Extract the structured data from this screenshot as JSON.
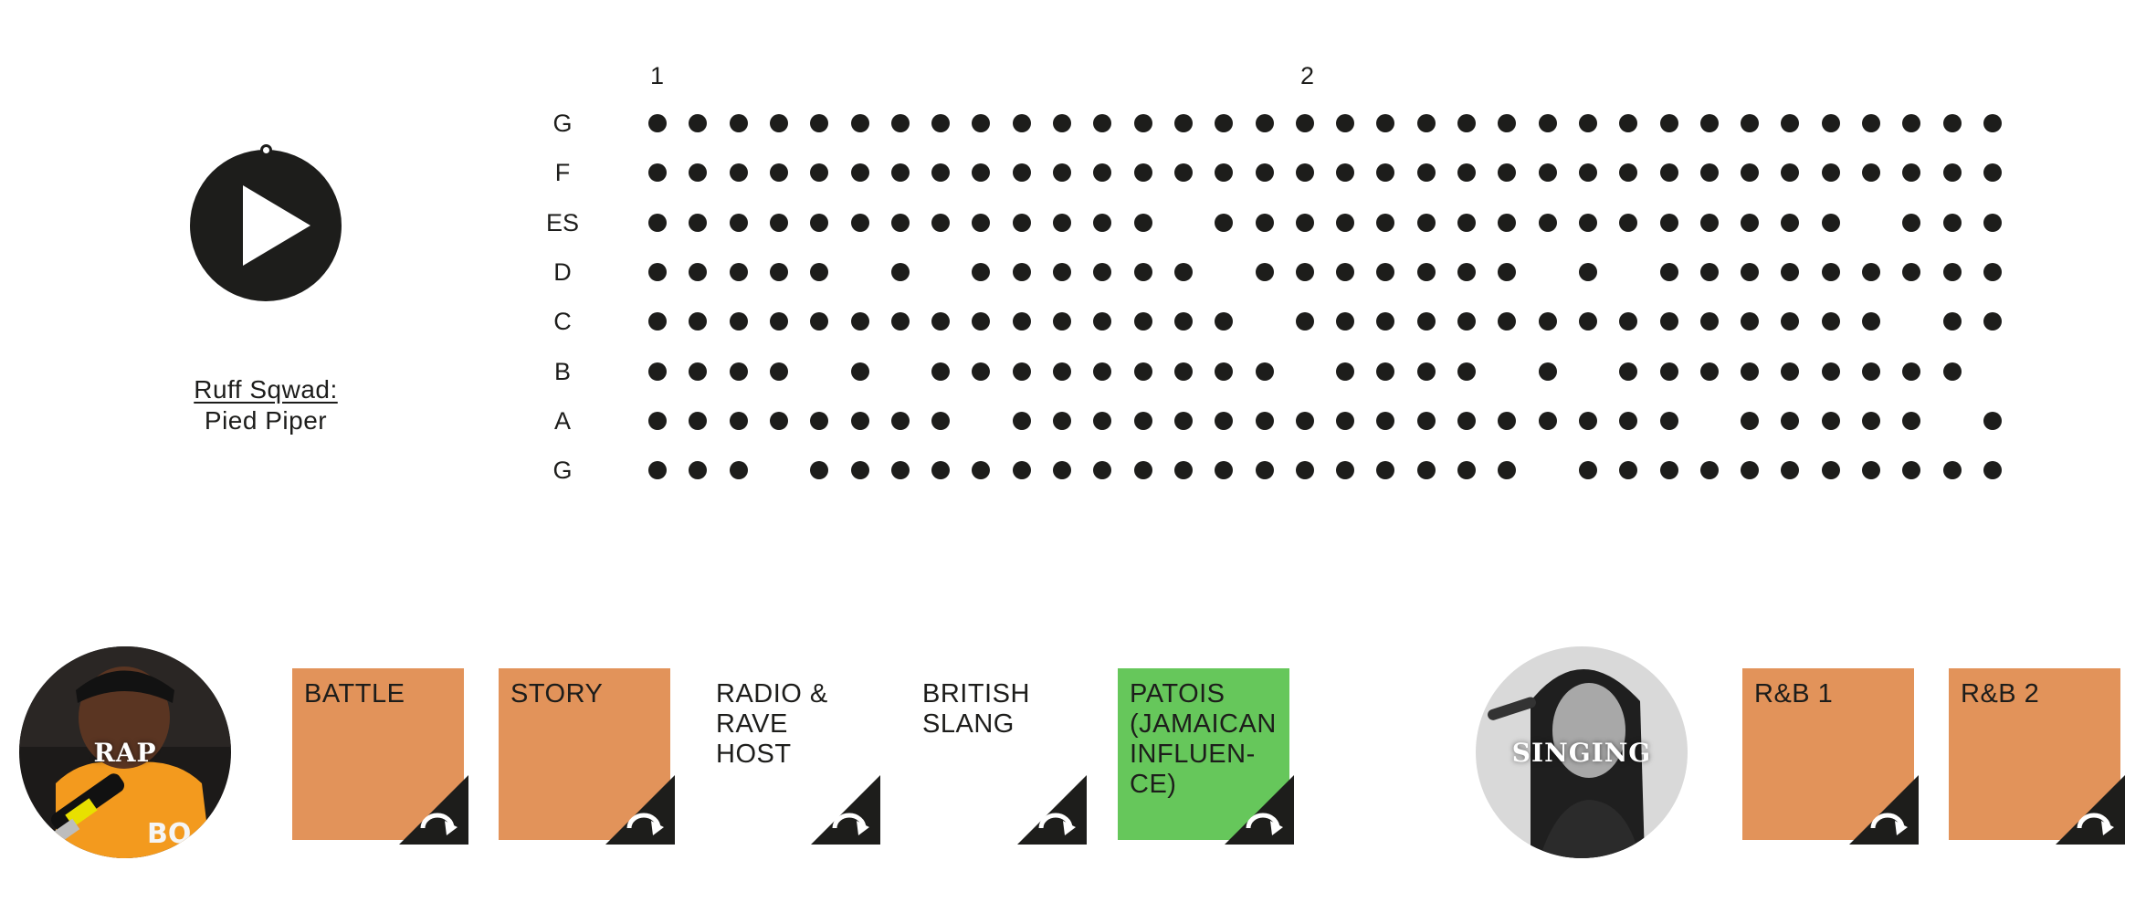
{
  "player": {
    "play_icon": "play-icon",
    "artist": "Ruff Sqwad:",
    "title": "Pied Piper"
  },
  "sequencer": {
    "beat_markers": [
      "1",
      "2"
    ],
    "rows": [
      {
        "note": "G",
        "pattern": "1111111111111111111111111111111111"
      },
      {
        "note": "F",
        "pattern": "1111111111111111111111111111111111"
      },
      {
        "note": "ES",
        "pattern": "1111111111111011111111111111110111"
      },
      {
        "note": "D",
        "pattern": "1111101011111101111111010111111111"
      },
      {
        "note": "C",
        "pattern": "1111111111111110111111111111111011"
      },
      {
        "note": "B",
        "pattern": "1111010111111111011110101111111110"
      },
      {
        "note": "A",
        "pattern": "1111111101111111111111111101111101"
      },
      {
        "note": "G",
        "pattern": "1110111111111111111111011111111111"
      }
    ]
  },
  "colors": {
    "dot": "#1d1d1b",
    "tile_orange": "#e2935a",
    "tile_green": "#66c75b",
    "corner": "#1d1d1b"
  },
  "categories": {
    "rap": {
      "label": "RAP",
      "tiles": [
        {
          "label": "BATTLE",
          "style": "orange"
        },
        {
          "label": "STORY",
          "style": "orange"
        },
        {
          "label": "RADIO &\nRAVE HOST",
          "style": "plain"
        },
        {
          "label": "BRITISH\nSLANG",
          "style": "plain"
        },
        {
          "label": "PATOIS\n(JAMAICAN\nINFLUEN-\nCE)",
          "style": "green"
        }
      ]
    },
    "singing": {
      "label": "SINGING",
      "tiles": [
        {
          "label": "R&B 1",
          "style": "orange"
        },
        {
          "label": "R&B 2",
          "style": "orange"
        }
      ]
    }
  },
  "icons": {
    "corner": "rotate-arrow-icon"
  }
}
